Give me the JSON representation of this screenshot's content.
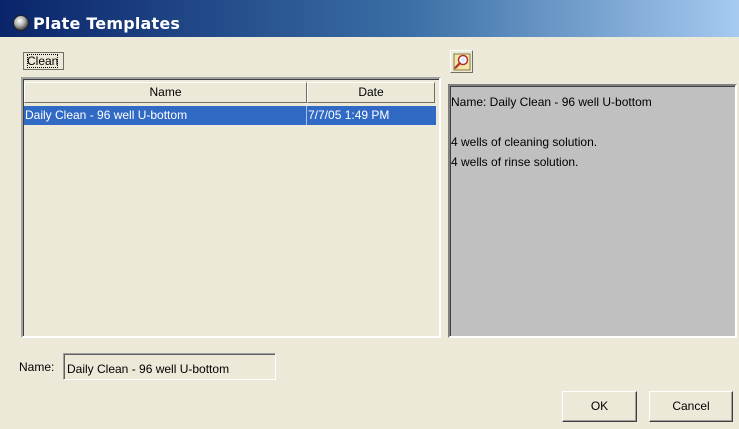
{
  "window": {
    "title": "Plate Templates"
  },
  "category_tab": {
    "label": "Clean"
  },
  "table": {
    "columns": [
      "Name",
      "Date"
    ],
    "rows": [
      {
        "name": "Daily Clean - 96 well U-bottom",
        "date": "7/7/05 1:49 PM",
        "selected": true
      }
    ]
  },
  "preview": {
    "icon": "magnifier-icon",
    "lines": [
      "Name: Daily Clean - 96 well U-bottom",
      "",
      "4 wells of cleaning solution.",
      "4 wells of rinse solution."
    ]
  },
  "name_field": {
    "label": "Name:",
    "value": "Daily Clean - 96 well U-bottom"
  },
  "buttons": {
    "ok": "OK",
    "cancel": "Cancel"
  },
  "colors": {
    "selection": "#316ac5",
    "titlebar": "#0a246a",
    "dialog_bg": "#ece9d8",
    "preview_bg": "#c0c0c0"
  }
}
